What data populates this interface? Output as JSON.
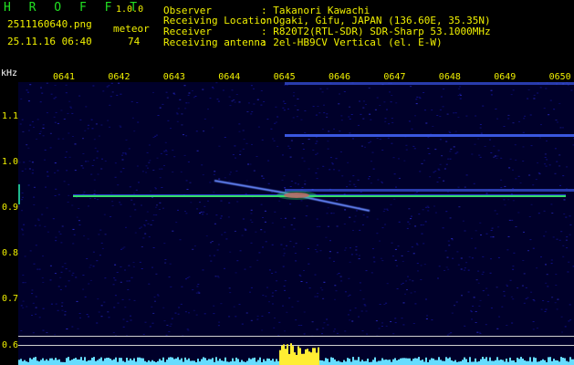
{
  "header": {
    "app_name": "H R O F F T",
    "version": "1.0.0",
    "filename": "2511160640.png",
    "datetime": "25.11.16 06:40",
    "meteor_label": "meteor",
    "meteor_count": "74",
    "observer_label": "Observer",
    "observer_value": ": Takanori Kawachi",
    "location_label": "Receiving Location",
    "location_value": ": Ogaki, Gifu, JAPAN (136.60E, 35.35N)",
    "receiver_label": "Receiver",
    "receiver_value": ": R820T2(RTL-SDR) SDR-Sharp 53.1000MHz",
    "antenna_label": "Receiving antenna",
    "antenna_value": ": 2el-HB9CV Vertical (el. E-W)"
  },
  "axis": {
    "unit": "kHz",
    "time_ticks": [
      "0641",
      "0642",
      "0643",
      "0644",
      "0645",
      "0646",
      "0647",
      "0648",
      "0649",
      "0650"
    ],
    "freq_ticks": [
      "1.1",
      "1.0",
      "0.9",
      "0.8",
      "0.7",
      "0.6"
    ]
  },
  "colors": {
    "background": "#00002a",
    "noise": "#10108a",
    "carrier": "#33dd66",
    "meteor": "#ff3366",
    "amplitude": "#66ddff",
    "label": "#f0f000"
  }
}
